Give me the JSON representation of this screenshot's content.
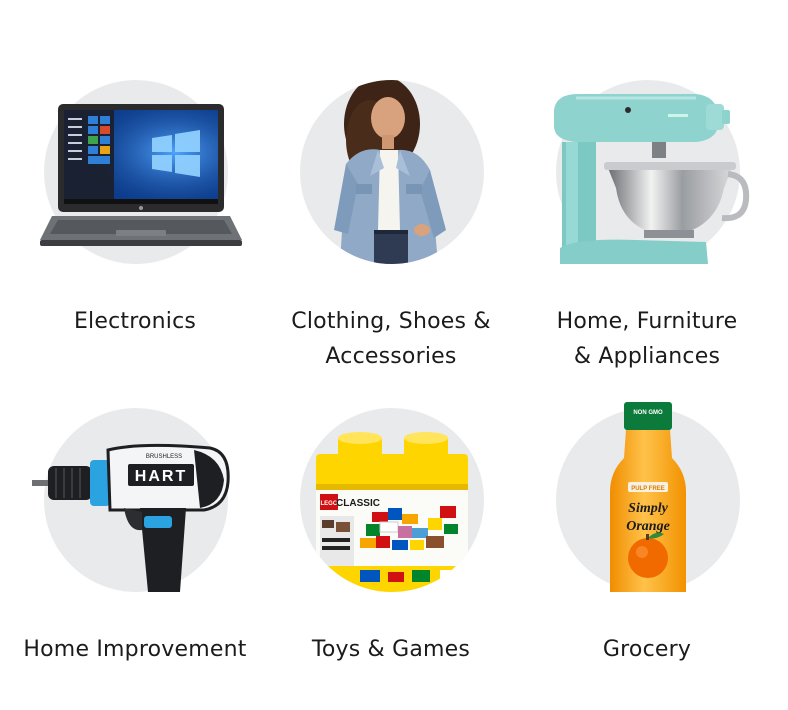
{
  "categories": [
    {
      "line1": "Electronics",
      "line2": "",
      "icon": "laptop-icon"
    },
    {
      "line1": "Clothing, Shoes &",
      "line2": "Accessories",
      "icon": "denim-jacket-model-image"
    },
    {
      "line1": "Home, Furniture",
      "line2": "& Appliances",
      "icon": "stand-mixer-icon"
    },
    {
      "line1": "Home Improvement",
      "line2": "",
      "icon": "power-drill-icon"
    },
    {
      "line1": "Toys & Games",
      "line2": "",
      "icon": "lego-box-icon"
    },
    {
      "line1": "Grocery",
      "line2": "",
      "icon": "orange-juice-bottle-icon"
    }
  ],
  "product_text": {
    "drill_brand": "HART",
    "drill_badge": "BRUSHLESS",
    "lego_brand": "LEGO",
    "lego_line": "CLASSIC",
    "juice_cap": "NON GMO",
    "juice_badge": "PULP FREE",
    "juice_brand_1": "Simply",
    "juice_brand_2": "Orange"
  },
  "colors": {
    "disc": "#e9eaec",
    "text": "#1b1b1b",
    "laptop_screen": "#1565c0",
    "mixer_body": "#8fd3cf",
    "drill_accent": "#2aa3e0",
    "lego_yellow": "#ffd500",
    "juice_orange": "#ffa41b",
    "juice_cap": "#0c7a3a"
  }
}
